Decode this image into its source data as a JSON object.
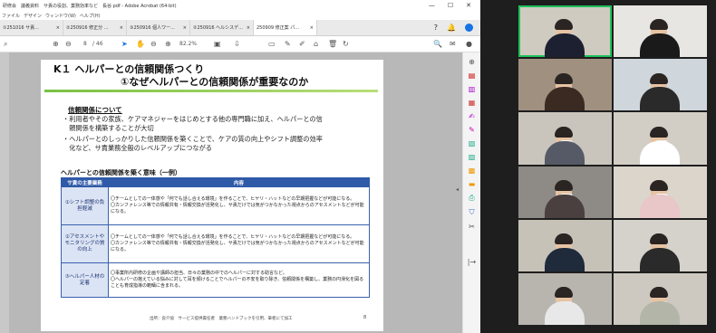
{
  "acrobat": {
    "title": "研修会　議義資料　サ責の役割、業務効率など　長谷.pdf - Adobe Acrobat (64-bit)",
    "window_controls": [
      "—",
      "☐",
      "✕"
    ],
    "menu": [
      "ファイル",
      "デザイン",
      "ウィンドウ(W)",
      "ヘルプ(H)"
    ],
    "tabs": [
      "①251016 サ責...",
      "②250916 修正分 ...",
      "③250916 個人ワー...",
      "②250916 ヘルシスデ...",
      "250909 修正案 パ..."
    ],
    "toolbar": {
      "page_current": "8",
      "page_total": "/ 46",
      "zoom": "82.2%"
    }
  },
  "slide": {
    "title_line1": "K１ ヘルパーとの信頼関係つくり",
    "title_line2": "①なぜヘルパーとの信頼関係が重要なのか",
    "section_heading": "信頼関係について",
    "bullets": [
      "・利用者やその家族、ケアマネジャーをはじめとする他の専門職に加え、ヘルパーとの信",
      "　頼関係を構築することが大切",
      "・ヘルパーとのしっかりした信頼関係を築くことで、ケアの質の向上やシフト調整の効率",
      "　化など、サ責業務全般のレベルアップにつながる"
    ],
    "table_title": "ヘルパーとの信頼関係を築く意味（一例）",
    "table_headers": [
      "サ責の主要業務",
      "内容"
    ],
    "table_rows": [
      {
        "task": "①シフト調整の負担軽減",
        "content": "〇チームとしての一体感や「何でも話し合える環境」を作ることで、ヒヤリ・ハットなどの早期把握などが可能になる。\n〇カンファレンス等での情報共有・情報交換が活発化し、サ責だけでは気がつかなかった視点からのアセスメントなどが可能になる。"
      },
      {
        "task": "②アセスメントやモニタリングの質の向上",
        "content": "〇チームとしての一体感や「何でも話し合える環境」を作ることで、ヒヤリ・ハットなどの早期把握などが可能になる。\n〇カンファレンス等での情報共有・情報交換が活発化し、サ責だけでは気がつかなかった視点からのアセスメントなどが可能になる。"
      },
      {
        "task": "③ヘルパー人材の定着",
        "content": "〇事業所内研修の企画や講師の担当、日々の業務の中でのヘルパーに対する助言など。\n〇ヘルパーの抱えている悩みに対して耳を傾けることでヘルパーの不安を取り除き、信頼関係を構築し、業務の円滑化を図ることも育成指導の範疇に含まれる。"
      }
    ],
    "footer": "出所：良介協　サービス提供責任者　業務ハンドブックを引用、筆者にて加工",
    "page_number": "8"
  },
  "participants": [
    {
      "id": "p1",
      "active": true,
      "shirt": "#1c2030",
      "bg": "#cfcbc0"
    },
    {
      "id": "p2",
      "active": false,
      "shirt": "#1a1a1a",
      "bg": "#e8e6e2"
    },
    {
      "id": "p3",
      "active": false,
      "shirt": "#3a2a22",
      "bg": "#a09080"
    },
    {
      "id": "p4",
      "active": false,
      "shirt": "#2a2a2a",
      "bg": "#cfd6dc"
    },
    {
      "id": "p5",
      "active": false,
      "shirt": "#555a66",
      "bg": "#c9c5bd"
    },
    {
      "id": "p6",
      "active": false,
      "shirt": "#ffffff",
      "bg": "#d2cec6"
    },
    {
      "id": "p7",
      "active": false,
      "shirt": "#4a4040",
      "bg": "#8e8a86"
    },
    {
      "id": "p8",
      "active": false,
      "shirt": "#e9c6c8",
      "bg": "#dbd5cc"
    },
    {
      "id": "p9",
      "active": false,
      "shirt": "#1f2a3a",
      "bg": "#c7c2b8"
    },
    {
      "id": "p10",
      "active": false,
      "shirt": "#2a2a2a",
      "bg": "#d5d2cc"
    },
    {
      "id": "p11",
      "active": false,
      "shirt": "#e8e8e8",
      "bg": "#b8b4ae"
    },
    {
      "id": "p12",
      "active": false,
      "shirt": "#b3b5a8",
      "bg": "#cdc9c1"
    }
  ]
}
